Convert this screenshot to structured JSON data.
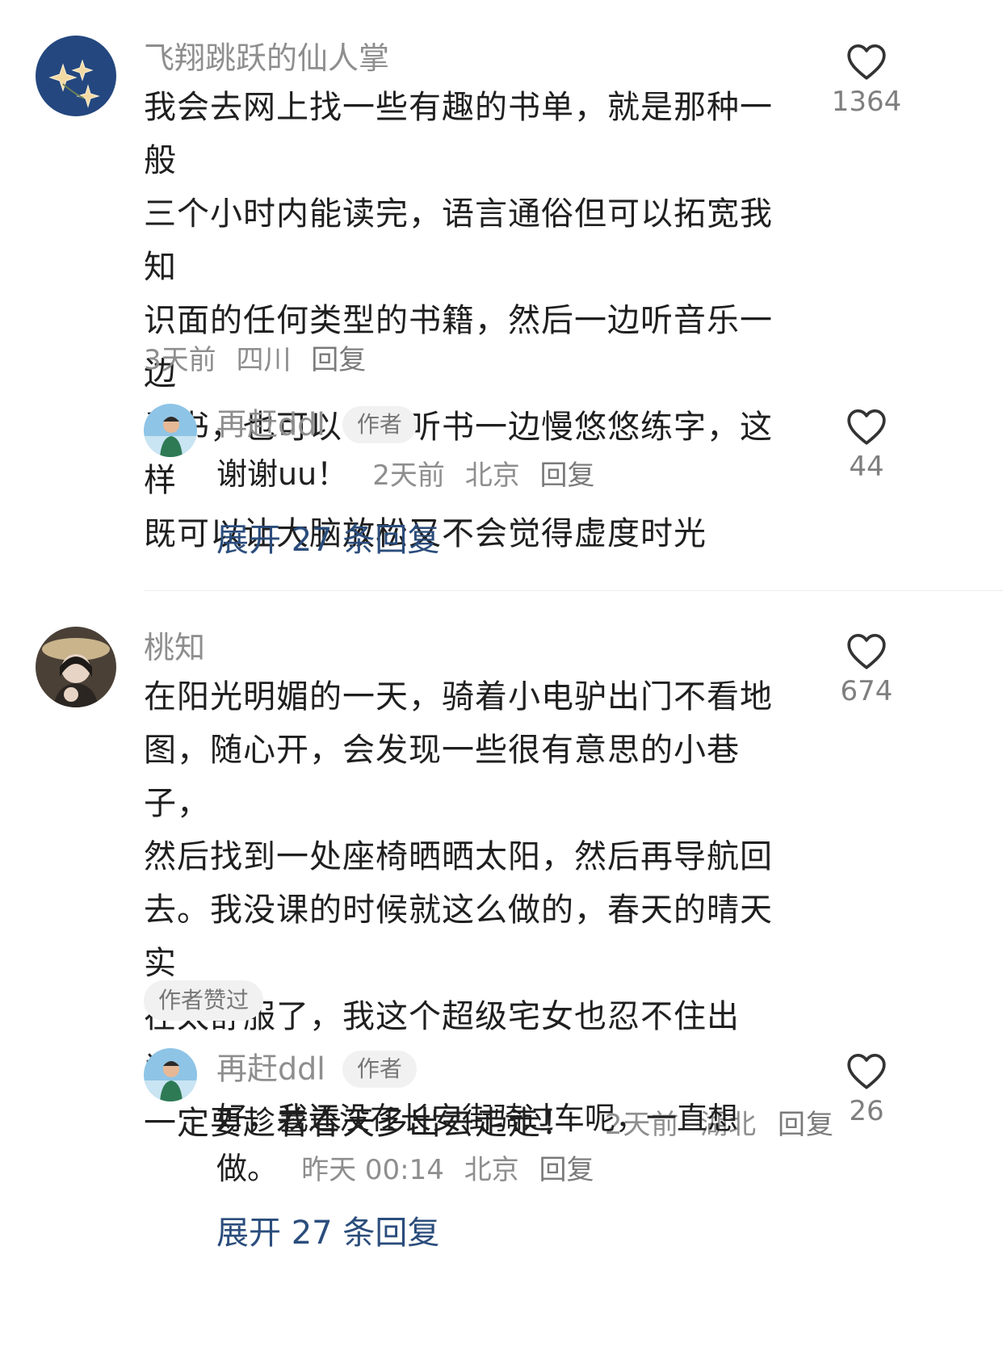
{
  "comments": [
    {
      "username": "飞翔跳跃的仙人掌",
      "text_lines": [
        "我会去网上找一些有趣的书单，就是那种一般",
        "三个小时内能读完，语言通俗但可以拓宽我知",
        "识面的任何类型的书籍，然后一边听音乐一边",
        "看书，也可以一边听书一边慢悠悠练字，这样",
        "既可以让大脑放松又不会觉得虚度时光"
      ],
      "time": "3天前",
      "location": "四川",
      "reply_label": "回复",
      "likes": "1364",
      "author_reply": {
        "username": "再赶ddl",
        "tag": "作者",
        "text": "谢谢uu！",
        "time": "2天前",
        "location": "北京",
        "reply_label": "回复",
        "likes": "44"
      },
      "expand_label": "展开 27 条回复"
    },
    {
      "username": "桃知",
      "text_lines": [
        "在阳光明媚的一天，骑着小电驴出门不看地",
        "图，随心开，会发现一些很有意思的小巷子，",
        "然后找到一处座椅晒晒太阳，然后再导航回",
        "去。我没课的时候就这么做的，春天的晴天实",
        "在太舒服了，我这个超级宅女也忍不住出门。",
        "一定要趁着春天多出去走走！"
      ],
      "time": "2天前",
      "location": "湖北",
      "reply_label": "回复",
      "liked_by_author": "作者赞过",
      "likes": "674",
      "author_reply": {
        "username": "再赶ddl",
        "tag": "作者",
        "text_lines": [
          "好，我还没在长安街骑过车呢，一直想",
          "做。"
        ],
        "time": "昨天 00:14",
        "location": "北京",
        "reply_label": "回复",
        "likes": "26"
      },
      "expand_label": "展开 27 条回复"
    }
  ],
  "icons": {
    "like": "heart-outline-icon"
  },
  "colors": {
    "link": "#2b4d7c",
    "meta": "#8e8e8e",
    "tag_bg": "#f1f1f1"
  }
}
